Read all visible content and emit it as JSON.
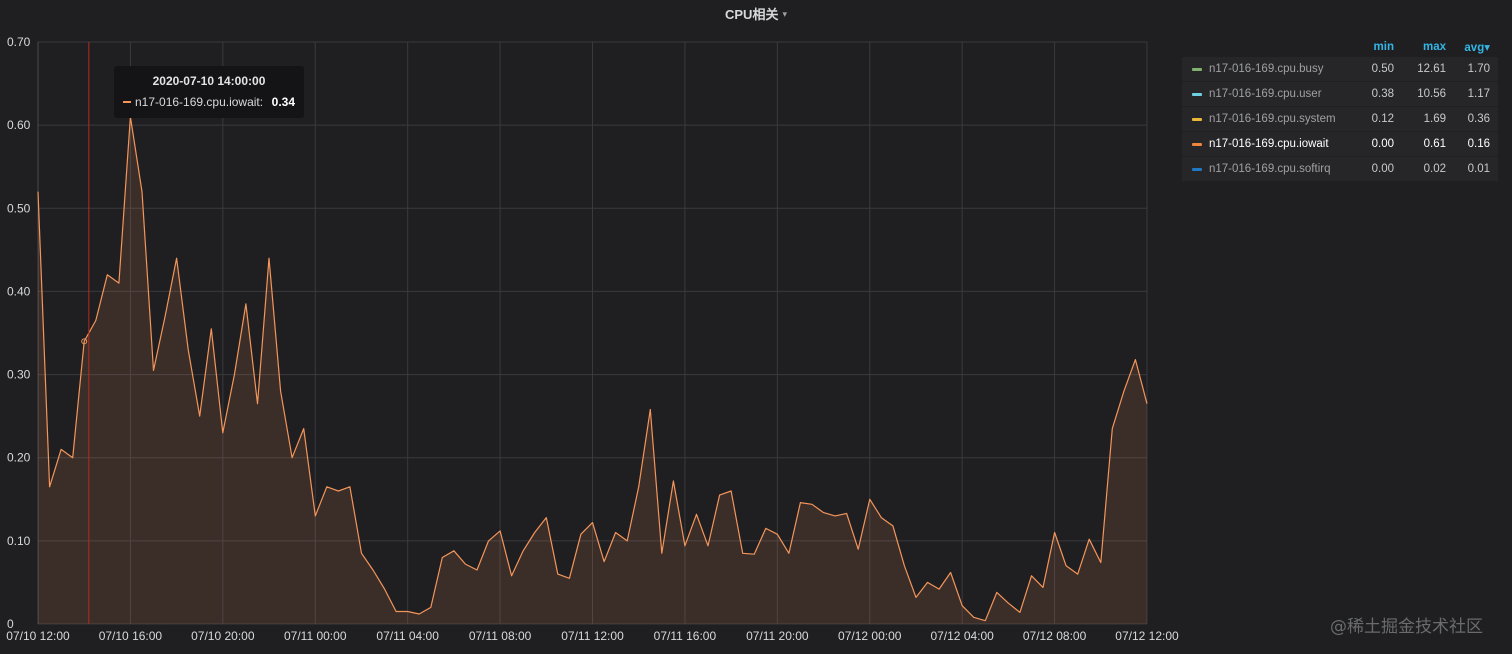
{
  "panel": {
    "title": "CPU相关",
    "caret": "▾"
  },
  "legend": {
    "headers": {
      "min": "min",
      "max": "max",
      "avg": "avg▾"
    },
    "rows": [
      {
        "name": "n17-016-169.cpu.busy",
        "color": "#7eb26d",
        "min": "0.50",
        "max": "12.61",
        "avg": "1.70",
        "active": false
      },
      {
        "name": "n17-016-169.cpu.user",
        "color": "#6ed0e0",
        "min": "0.38",
        "max": "10.56",
        "avg": "1.17",
        "active": false
      },
      {
        "name": "n17-016-169.cpu.system",
        "color": "#eab839",
        "min": "0.12",
        "max": "1.69",
        "avg": "0.36",
        "active": false
      },
      {
        "name": "n17-016-169.cpu.iowait",
        "color": "#ef843c",
        "min": "0.00",
        "max": "0.61",
        "avg": "0.16",
        "active": true
      },
      {
        "name": "n17-016-169.cpu.softirq",
        "color": "#1f78c1",
        "min": "0.00",
        "max": "0.02",
        "avg": "0.01",
        "active": false
      }
    ]
  },
  "tooltip": {
    "time": "2020-07-10 14:00:00",
    "series": "n17-016-169.cpu.iowait:",
    "value": "0.34"
  },
  "watermark": "@稀土掘金技术社区",
  "chart_data": {
    "type": "area",
    "title": "CPU相关",
    "xlabel": "",
    "ylabel": "",
    "x_unit": "hours since 07/10 12:00",
    "ylim": [
      0,
      0.7
    ],
    "xlim": [
      0,
      48
    ],
    "grid": true,
    "legend_placement": "right",
    "y_ticks": [
      "0",
      "0.10",
      "0.20",
      "0.30",
      "0.40",
      "0.50",
      "0.60",
      "0.70"
    ],
    "y_tick_values": [
      0,
      0.1,
      0.2,
      0.3,
      0.4,
      0.5,
      0.6,
      0.7
    ],
    "x_ticks": [
      "07/10 12:00",
      "07/10 16:00",
      "07/10 20:00",
      "07/11 00:00",
      "07/11 04:00",
      "07/11 08:00",
      "07/11 12:00",
      "07/11 16:00",
      "07/11 20:00",
      "07/12 00:00",
      "07/12 04:00",
      "07/12 08:00",
      "07/12 12:00"
    ],
    "x_tick_values": [
      0,
      4,
      8,
      12,
      16,
      20,
      24,
      28,
      32,
      36,
      40,
      44,
      48
    ],
    "crosshair_x": 2.2,
    "hover_point": {
      "x": 2.0,
      "y": 0.34
    },
    "series": [
      {
        "name": "n17-016-169.cpu.iowait",
        "color": "#f4955a",
        "x": [
          0,
          0.5,
          1,
          1.5,
          2,
          2.5,
          3,
          3.5,
          4,
          4.5,
          5,
          5.5,
          6,
          6.5,
          7,
          7.5,
          8,
          8.5,
          9,
          9.5,
          10,
          10.5,
          11,
          11.5,
          12,
          12.5,
          13,
          13.5,
          14,
          14.5,
          15,
          15.5,
          16,
          16.5,
          17,
          17.5,
          18,
          18.5,
          19,
          19.5,
          20,
          20.5,
          21,
          21.5,
          22,
          22.5,
          23,
          23.5,
          24,
          24.5,
          25,
          25.5,
          26,
          26.5,
          27,
          27.5,
          28,
          28.5,
          29,
          29.5,
          30,
          30.5,
          31,
          31.5,
          32,
          32.5,
          33,
          33.5,
          34,
          34.5,
          35,
          35.5,
          36,
          36.5,
          37,
          37.5,
          38,
          38.5,
          39,
          39.5,
          40,
          40.5,
          41,
          41.5,
          42,
          42.5,
          43,
          43.5,
          44,
          44.5,
          45,
          45.5,
          46,
          46.5,
          47,
          47.5,
          48
        ],
        "values": [
          0.52,
          0.165,
          0.21,
          0.2,
          0.34,
          0.365,
          0.42,
          0.41,
          0.61,
          0.52,
          0.305,
          0.37,
          0.44,
          0.33,
          0.25,
          0.355,
          0.23,
          0.3,
          0.385,
          0.265,
          0.44,
          0.28,
          0.2,
          0.235,
          0.13,
          0.165,
          0.16,
          0.165,
          0.085,
          0.065,
          0.042,
          0.015,
          0.015,
          0.012,
          0.02,
          0.08,
          0.088,
          0.072,
          0.065,
          0.1,
          0.112,
          0.058,
          0.088,
          0.11,
          0.128,
          0.06,
          0.055,
          0.108,
          0.122,
          0.075,
          0.11,
          0.1,
          0.165,
          0.258,
          0.085,
          0.172,
          0.094,
          0.132,
          0.094,
          0.155,
          0.16,
          0.085,
          0.084,
          0.115,
          0.108,
          0.085,
          0.146,
          0.144,
          0.134,
          0.13,
          0.133,
          0.09,
          0.15,
          0.128,
          0.118,
          0.07,
          0.032,
          0.05,
          0.042,
          0.062,
          0.022,
          0.008,
          0.004,
          0.038,
          0.025,
          0.014,
          0.058,
          0.044,
          0.11,
          0.07,
          0.06,
          0.102,
          0.074,
          0.235,
          0.28,
          0.318,
          0.265
        ]
      }
    ]
  }
}
